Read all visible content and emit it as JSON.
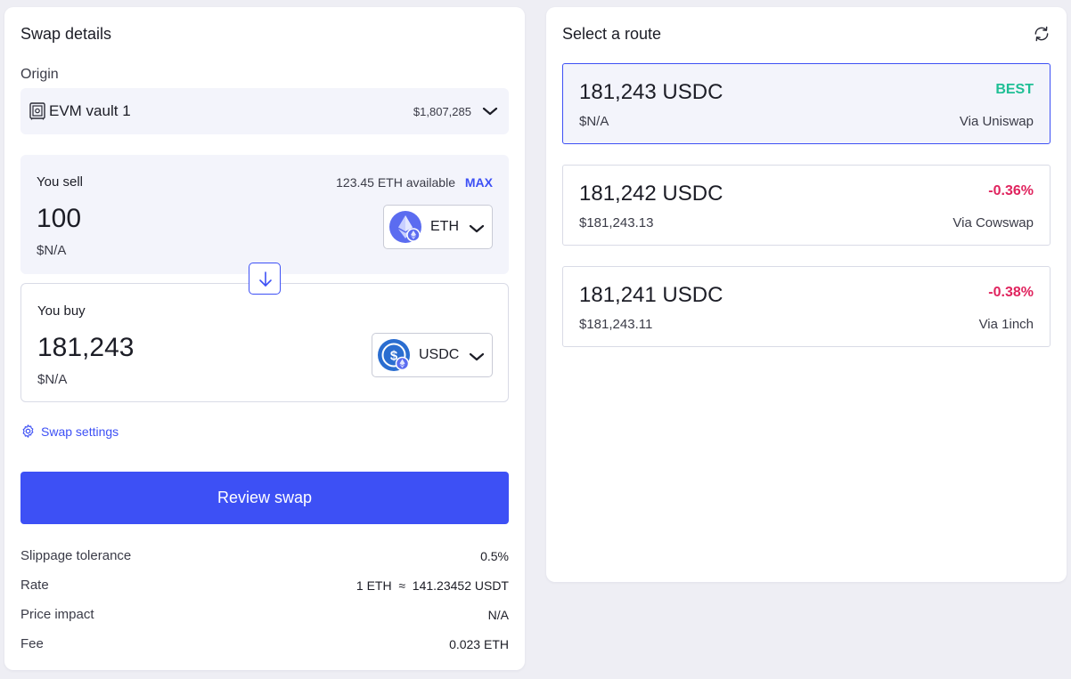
{
  "swap": {
    "title": "Swap details",
    "origin_label": "Origin",
    "origin": {
      "name": "EVM vault 1",
      "balance": "$1,807,285"
    },
    "sell": {
      "label": "You sell",
      "available": "123.45 ETH available",
      "max_label": "MAX",
      "amount": "100",
      "usd": "$N/A",
      "token": "ETH"
    },
    "buy": {
      "label": "You buy",
      "amount": "181,243",
      "usd": "$N/A",
      "token": "USDC"
    },
    "settings_label": "Swap settings",
    "review_label": "Review swap",
    "details": [
      {
        "key": "Slippage tolerance",
        "value": "0.5%"
      },
      {
        "key": "Rate",
        "value": "1 ETH  ≈  141.23452 USDT"
      },
      {
        "key": "Price impact",
        "value": "N/A"
      },
      {
        "key": "Fee",
        "value": "0.023 ETH"
      }
    ]
  },
  "routes": {
    "title": "Select a route",
    "items": [
      {
        "amount": "181,243 USDC",
        "badge": "BEST",
        "usd": "$N/A",
        "via": "Via Uniswap"
      },
      {
        "amount": "181,242 USDC",
        "badge": "-0.36%",
        "usd": "$181,243.13",
        "via": "Via Cowswap"
      },
      {
        "amount": "181,241 USDC",
        "badge": "-0.38%",
        "usd": "$181,243.11",
        "via": "Via 1inch"
      }
    ]
  },
  "colors": {
    "accent": "#3d50f5",
    "best": "#1fbf95",
    "negative": "#e0245e",
    "panel_tint": "#f3f4fb"
  },
  "icons": {
    "vault": "vault-icon",
    "eth": "eth-token-icon",
    "usdc": "usdc-token-icon",
    "chevron": "chevron-down-icon",
    "swap_direction": "arrow-down-icon",
    "settings": "gear-icon",
    "refresh": "refresh-icon"
  }
}
